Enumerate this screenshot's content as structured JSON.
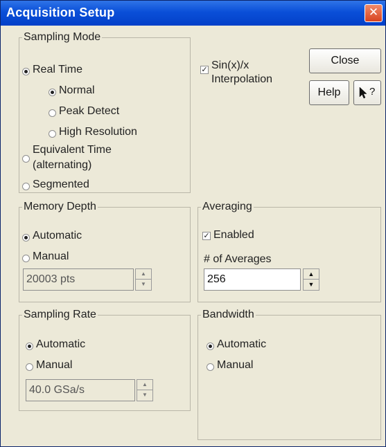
{
  "window": {
    "title": "Acquisition Setup",
    "close_glyph": "✕"
  },
  "sampling_mode": {
    "legend": "Sampling Mode",
    "real_time": "Real Time",
    "normal": "Normal",
    "peak_detect": "Peak Detect",
    "high_resolution": "High Resolution",
    "equivalent_time_1": "Equivalent Time",
    "equivalent_time_2": "(alternating)",
    "segmented": "Segmented"
  },
  "sinx": {
    "label_1": "Sin(x)/x",
    "label_2": "Interpolation",
    "checked": true
  },
  "buttons": {
    "close": "Close",
    "help": "Help",
    "whats_this_glyph": "?"
  },
  "memory_depth": {
    "legend": "Memory Depth",
    "automatic": "Automatic",
    "manual": "Manual",
    "value": "20003 pts"
  },
  "averaging": {
    "legend": "Averaging",
    "enabled": "Enabled",
    "count_label": "# of Averages",
    "count_value": "256"
  },
  "sampling_rate": {
    "legend": "Sampling Rate",
    "automatic": "Automatic",
    "manual": "Manual",
    "value": "40.0 GSa/s"
  },
  "bandwidth": {
    "legend": "Bandwidth",
    "automatic": "Automatic",
    "manual": "Manual"
  },
  "glyphs": {
    "check": "✓",
    "spin_up": "▲",
    "spin_down": "▼"
  },
  "colors": {
    "titlebar": "#0a4fd8",
    "dialog_face": "#ece9d8",
    "close_button": "#d84320"
  }
}
